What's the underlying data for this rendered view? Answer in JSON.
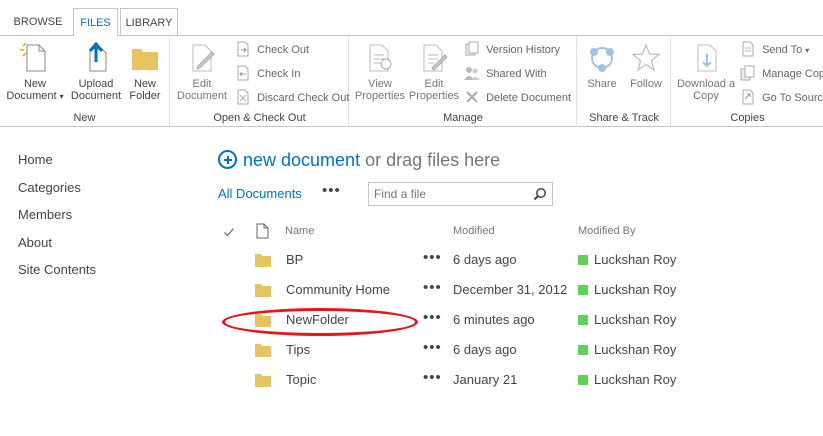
{
  "ribbon_tabs": [
    {
      "label": "BROWSE"
    },
    {
      "label": "FILES",
      "selected": true
    },
    {
      "label": "LIBRARY"
    }
  ],
  "ribbon": {
    "new_group": {
      "label": "New",
      "new_document_1": "New",
      "new_document_2": "Document",
      "upload_1": "Upload",
      "upload_2": "Document",
      "new_folder_1": "New",
      "new_folder_2": "Folder"
    },
    "open_group": {
      "label": "Open & Check Out",
      "edit_1": "Edit",
      "edit_2": "Document",
      "check_out": "Check Out",
      "check_in": "Check In",
      "discard": "Discard Check Out"
    },
    "manage_group": {
      "label": "Manage",
      "view_props_1": "View",
      "view_props_2": "Properties",
      "edit_props_1": "Edit",
      "edit_props_2": "Properties",
      "version_history": "Version History",
      "shared_with": "Shared With",
      "delete_document": "Delete Document"
    },
    "share_group": {
      "label": "Share & Track",
      "share": "Share",
      "follow": "Follow"
    },
    "copies_group": {
      "label": "Copies",
      "download_1": "Download a",
      "download_2": "Copy",
      "send_to": "Send To",
      "manage_copies": "Manage Copies",
      "go_to_source": "Go To Source"
    }
  },
  "left_nav": [
    {
      "label": "Home"
    },
    {
      "label": "Categories"
    },
    {
      "label": "Members"
    },
    {
      "label": "About"
    },
    {
      "label": "Site Contents"
    }
  ],
  "new_document": {
    "link_text": "new document",
    "rest_text": "or drag files here"
  },
  "view": {
    "current": "All Documents",
    "ellipsis": "•••",
    "search_placeholder": "Find a file"
  },
  "table": {
    "headers": {
      "name": "Name",
      "modified": "Modified",
      "modified_by": "Modified By"
    },
    "rows": [
      {
        "name": "BP",
        "modified": "6 days ago",
        "modified_by": "Luckshan Roy"
      },
      {
        "name": "Community Home",
        "modified": "December 31, 2012",
        "modified_by": "Luckshan Roy"
      },
      {
        "name": "NewFolder",
        "modified": "6 minutes ago",
        "modified_by": "Luckshan Roy"
      },
      {
        "name": "Tips",
        "modified": "6 days ago",
        "modified_by": "Luckshan Roy"
      },
      {
        "name": "Topic",
        "modified": "January 21",
        "modified_by": "Luckshan Roy"
      }
    ]
  },
  "colors": {
    "accent": "#0072c6",
    "folder": "#e7c45f",
    "presence": "#5dd255",
    "annotation": "#e0191f"
  }
}
